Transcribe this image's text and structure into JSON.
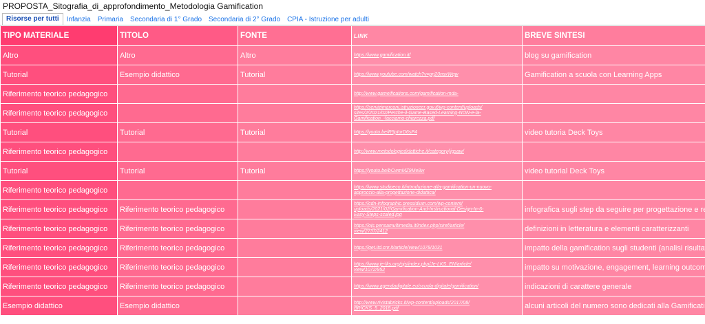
{
  "document_title": "PROPOSTA_Sitografia_di_approfondimento_Metodologia Gamification",
  "tabs": [
    {
      "label": "Risorse per tutti",
      "active": true
    },
    {
      "label": "Infanzia",
      "active": false
    },
    {
      "label": "Primaria",
      "active": false
    },
    {
      "label": "Secondaria di 1° Grado",
      "active": false
    },
    {
      "label": "Secondaria di 2° Grado",
      "active": false
    },
    {
      "label": "CPIA - Istruzione per adulti",
      "active": false
    }
  ],
  "table": {
    "headers": [
      "TIPO MATERIALE",
      "TITOLO",
      "FONTE",
      "LINK",
      "BREVE SINTESI"
    ],
    "rows": [
      {
        "tipo": "Altro",
        "titolo": "Altro",
        "fonte": "Altro",
        "link": [
          "https://www.gamification.it/"
        ],
        "sintesi": "blog su gamification"
      },
      {
        "tipo": "Tutorial",
        "titolo": "Esempio didattico",
        "fonte": "Tutorial",
        "link": [
          "https://www.youtube.com/watch?v=prj20nsxWqw"
        ],
        "sintesi": "Gamification a scuola con Learning Apps"
      },
      {
        "tipo": "Riferimento teorico pedagogico",
        "titolo": "",
        "fonte": "",
        "link": [
          "http://www.gameifications.com/gamification-mda-"
        ],
        "sintesi": ""
      },
      {
        "tipo": "Riferimento teorico pedagogico",
        "titolo": "",
        "fonte": "",
        "link": [
          "https://servizimarconi.istruzioneer.gov.it/wp-content/uploads/",
          "sites/2/2021/02/Perche-il-Game-Based-Learning-NON-e-la-",
          "Gamification_-facciamo-chiarezza.pdf"
        ],
        "sintesi": ""
      },
      {
        "tipo": "Tutorial",
        "titolo": "Tutorial",
        "fonte": "Tutorial",
        "link": [
          "https://youtu.be/R5pIorD6sP4"
        ],
        "sintesi": "video tutoria Deck Toys"
      },
      {
        "tipo": "Riferimento teorico pedagogico",
        "titolo": "",
        "fonte": "",
        "link": [
          "http://www.metodologiedidattiche.it/category/jigsaw/"
        ],
        "sintesi": ""
      },
      {
        "tipo": "Tutorial",
        "titolo": "Tutorial",
        "fonte": "Tutorial",
        "link": [
          "https://youtu.be/bCwmMZ9Me8w"
        ],
        "sintesi": "video tutorial Deck Toys"
      },
      {
        "tipo": "Riferimento teorico pedagogico",
        "titolo": "",
        "fonte": "",
        "link": [
          "https://www.studioeco.it/introduzione-alla-gamification-un-nuovo-",
          "approccio-alla-progettazione-didattica/"
        ],
        "sintesi": ""
      },
      {
        "tipo": "Riferimento teorico pedagogico",
        "titolo": "Riferimento teorico pedagogico",
        "fonte": "",
        "link": [
          "https://cdn-infographic.pressidium.com/wp-content/",
          "uploads/2021/02/Gamification-And-Instructional-Design-In-6-",
          "Easy-Steps-scaled.jpg"
        ],
        "sintesi": "infografica sugli step da seguire per progettazione e rea"
      },
      {
        "tipo": "Riferimento teorico pedagogico",
        "titolo": "Riferimento teorico pedagogico",
        "fonte": "",
        "link": [
          "https://ojs.pensamultimedia.it/index.php/siref/article/",
          "view/2737/2412"
        ],
        "sintesi": "definizioni in letteratura e elementi caratterizzanti"
      },
      {
        "tipo": "Riferimento teorico pedagogico",
        "titolo": "Riferimento teorico pedagogico",
        "fonte": "",
        "link": [
          "https://get.itd.cnr.it/article/view/1078/1031"
        ],
        "sintesi": "impatto della gamification sugli studenti (analisi risultati"
      },
      {
        "tipo": "Riferimento teorico pedagogico",
        "titolo": "Riferimento teorico pedagogico",
        "fonte": "",
        "link": [
          "https://www.je-lks.org/ojs/index.php/Je-LKS_EN/article/",
          "view/1072/952"
        ],
        "sintesi": "impatto su motivazione, engagement, learning outcome"
      },
      {
        "tipo": "Riferimento teorico pedagogico",
        "titolo": "Riferimento teorico pedagogico",
        "fonte": "",
        "link": [
          "https://www.agendadigitale.eu/scuola-digitale/gamification/"
        ],
        "sintesi": "indicazioni di carattere generale"
      },
      {
        "tipo": "Esempio didattico",
        "titolo": "Esempio didattico",
        "fonte": "",
        "link": [
          "http://www.rivistabricks.it/wp-content/uploads/2017/08/",
          "BRICKS_5_2018.pdf"
        ],
        "sintesi": "alcuni articoli del numero sono dedicati alla Gamification"
      }
    ]
  },
  "colors": {
    "col1": "#ff4f7e",
    "col2": "#ff6a90",
    "col3": "#ff7c9c",
    "col4": "#ff8fab",
    "col5": "#ff86a4",
    "tab_link": "#1a73e8"
  }
}
